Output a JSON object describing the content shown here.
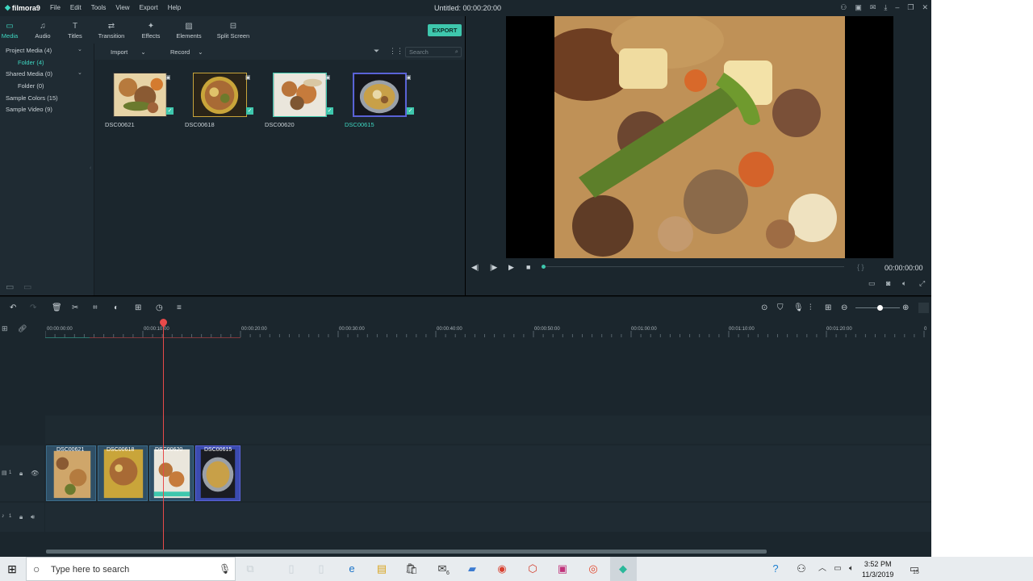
{
  "app": {
    "brand": "filmora9",
    "title": "Untitled:  00:00:20:00"
  },
  "menu": [
    "File",
    "Edit",
    "Tools",
    "View",
    "Export",
    "Help"
  ],
  "toolbar": {
    "tabs": [
      {
        "label": "Media",
        "icon": "folder-icon"
      },
      {
        "label": "Audio",
        "icon": "music-note-icon"
      },
      {
        "label": "Titles",
        "icon": "text-icon"
      },
      {
        "label": "Transition",
        "icon": "transition-icon"
      },
      {
        "label": "Effects",
        "icon": "effects-icon"
      },
      {
        "label": "Elements",
        "icon": "image-icon"
      },
      {
        "label": "Split Screen",
        "icon": "split-screen-icon"
      }
    ],
    "export_label": "EXPORT"
  },
  "library": {
    "items": [
      {
        "label": "Project Media (4)",
        "type": "group"
      },
      {
        "label": "Folder (4)",
        "type": "sub",
        "active": true
      },
      {
        "label": "Shared Media (0)",
        "type": "group"
      },
      {
        "label": "Folder (0)",
        "type": "sub"
      },
      {
        "label": "Sample Colors (15)",
        "type": "group"
      },
      {
        "label": "Sample Video (9)",
        "type": "group"
      }
    ]
  },
  "media_bar": {
    "import_label": "Import",
    "record_label": "Record",
    "search_placeholder": "Search"
  },
  "media_items": [
    {
      "name": "DSC00621",
      "selected": false
    },
    {
      "name": "DSC00618",
      "selected": false
    },
    {
      "name": "DSC00620",
      "selected": false
    },
    {
      "name": "DSC00615",
      "selected": true
    }
  ],
  "preview": {
    "timecode": "00:00:00:00",
    "brackets": "{ }"
  },
  "timeline": {
    "ruler_labels": [
      "00:00:00:00",
      "00:00:10:00",
      "00:00:20:00",
      "00:00:30:00",
      "00:00:40:00",
      "00:00:50:00",
      "00:01:00:00",
      "00:01:10:00",
      "00:01:20:00",
      "0"
    ],
    "clips": [
      "DSC00621",
      "DSC00618",
      "DSC00620",
      "DSC00615"
    ],
    "video_track_label": "1",
    "audio_track_label": "1"
  },
  "taskbar": {
    "search_placeholder": "Type here to search",
    "time": "3:52 PM",
    "date": "11/3/2019",
    "notification_count": "15",
    "mail_badge": "6"
  },
  "colors": {
    "accent": "#3ec7ad",
    "playhead": "#e84a4a",
    "panel": "#1f2b33",
    "background": "#1b262d"
  }
}
